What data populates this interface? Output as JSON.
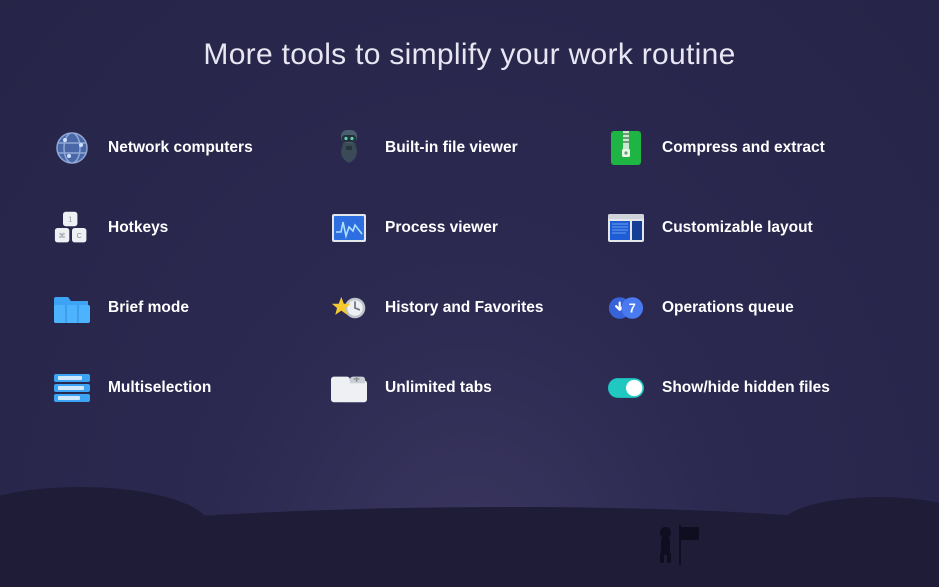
{
  "title": "More tools to simplify your work routine",
  "features": [
    {
      "label": "Network computers"
    },
    {
      "label": "Built-in file viewer"
    },
    {
      "label": "Compress and extract"
    },
    {
      "label": "Hotkeys"
    },
    {
      "label": "Process viewer"
    },
    {
      "label": "Customizable layout"
    },
    {
      "label": "Brief mode"
    },
    {
      "label": "History and Favorites"
    },
    {
      "label": "Operations queue"
    },
    {
      "label": "Multiselection"
    },
    {
      "label": "Unlimited tabs"
    },
    {
      "label": "Show/hide hidden files"
    }
  ]
}
